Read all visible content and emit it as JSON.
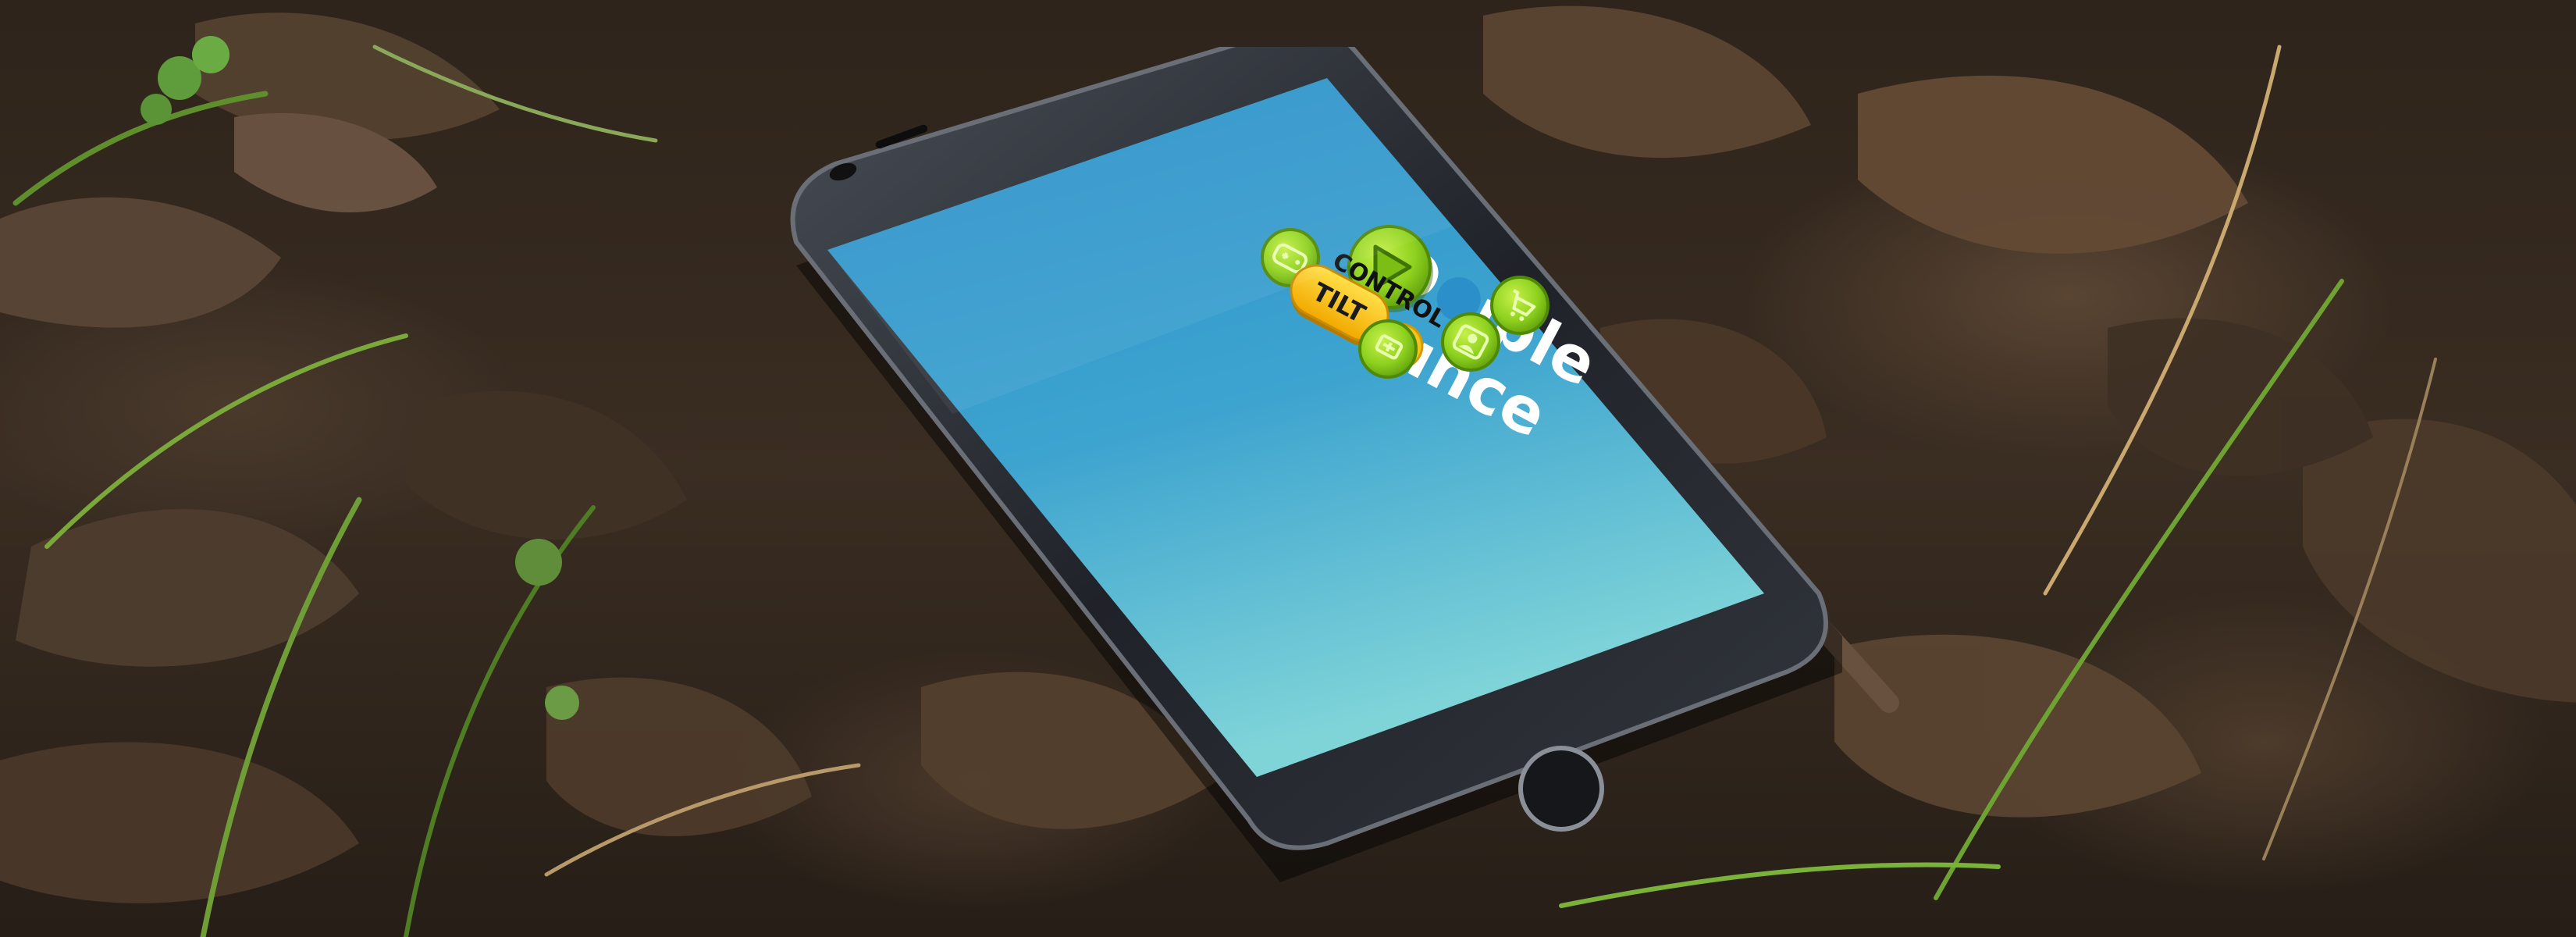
{
  "game": {
    "title_line1": "D   uble",
    "title_line2": "B   unce",
    "control_label": "CONTROL",
    "control_mode": "TILT"
  },
  "icons": {
    "play": "play-icon",
    "gamepad": "gamepad-icon",
    "achievements": "trophy-icon",
    "shop": "cart-icon",
    "profile": "person-icon",
    "leaderboard": "grid-icon"
  },
  "colors": {
    "screen_top": "#2b8fc9",
    "screen_bottom": "#7fd4d8",
    "button_green": "#8ed11f",
    "button_green_dark": "#5f9e0c",
    "ball_yellow": "#f6c21b",
    "tilt_yellow": "#ffcc1a",
    "phone_body": "#1f2228",
    "phone_frame": "#3b3f47"
  }
}
